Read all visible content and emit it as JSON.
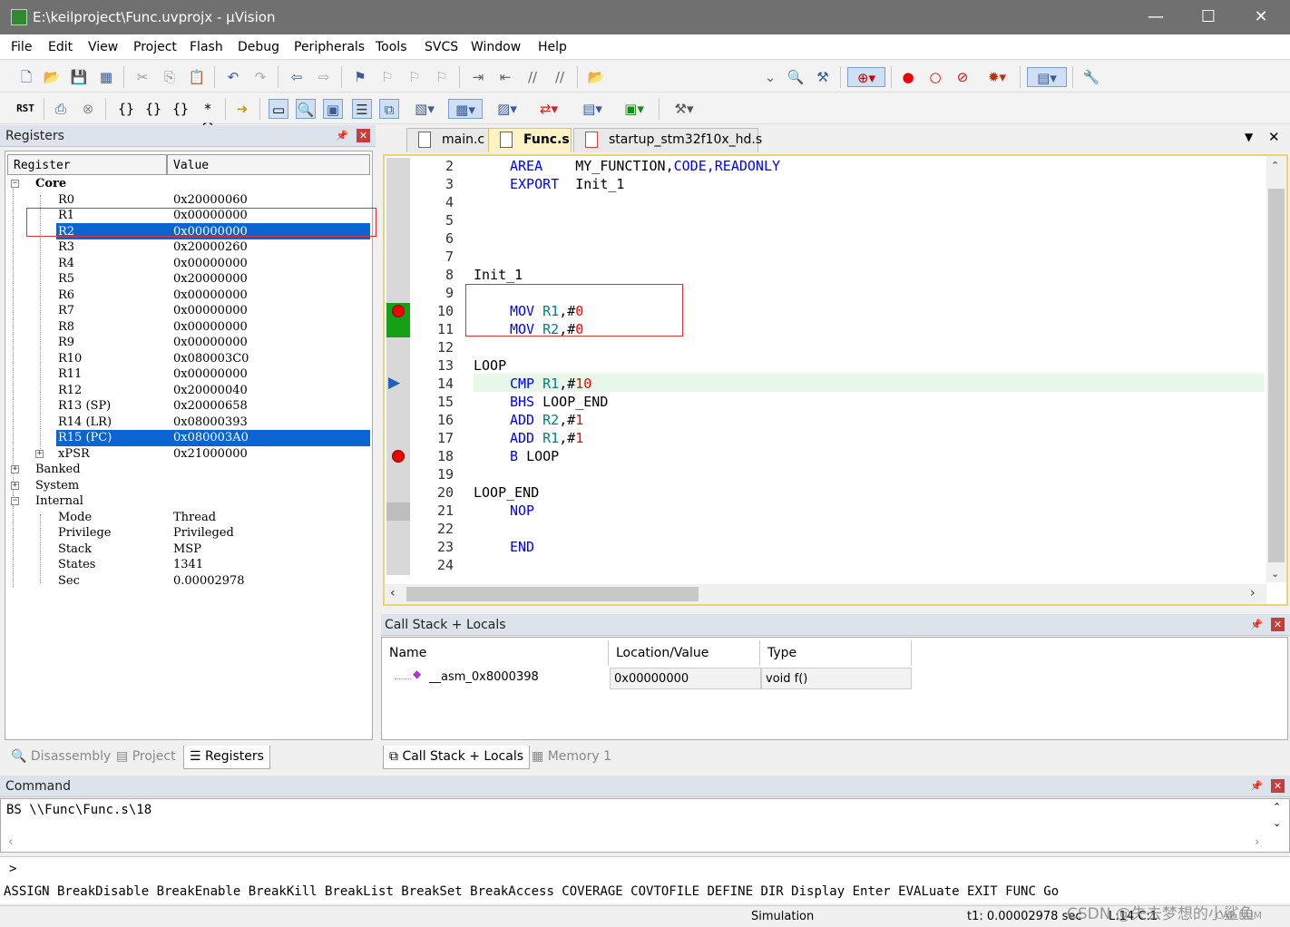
{
  "window": {
    "title": "E:\\keilproject\\Func.uvprojx - µVision",
    "minimize": "—",
    "maximize": "☐",
    "close": "✕"
  },
  "menu": [
    "File",
    "Edit",
    "View",
    "Project",
    "Flash",
    "Debug",
    "Peripherals",
    "Tools",
    "SVCS",
    "Window",
    "Help"
  ],
  "toolbar2": {
    "reset_label": "RST"
  },
  "registers": {
    "panel_title": "Registers",
    "col_register": "Register",
    "col_value": "Value",
    "rows": [
      {
        "name": "Core",
        "value": ""
      },
      {
        "name": "R0",
        "value": "0x20000060"
      },
      {
        "name": "R1",
        "value": "0x00000000"
      },
      {
        "name": "R2",
        "value": "0x00000000"
      },
      {
        "name": "R3",
        "value": "0x20000260"
      },
      {
        "name": "R4",
        "value": "0x00000000"
      },
      {
        "name": "R5",
        "value": "0x20000000"
      },
      {
        "name": "R6",
        "value": "0x00000000"
      },
      {
        "name": "R7",
        "value": "0x00000000"
      },
      {
        "name": "R8",
        "value": "0x00000000"
      },
      {
        "name": "R9",
        "value": "0x00000000"
      },
      {
        "name": "R10",
        "value": "0x080003C0"
      },
      {
        "name": "R11",
        "value": "0x00000000"
      },
      {
        "name": "R12",
        "value": "0x20000040"
      },
      {
        "name": "R13 (SP)",
        "value": "0x20000658"
      },
      {
        "name": "R14 (LR)",
        "value": "0x08000393"
      },
      {
        "name": "R15 (PC)",
        "value": "0x080003A0"
      },
      {
        "name": "xPSR",
        "value": "0x21000000"
      },
      {
        "name": "Banked",
        "value": ""
      },
      {
        "name": "System",
        "value": ""
      },
      {
        "name": "Internal",
        "value": ""
      },
      {
        "name": "Mode",
        "value": "Thread"
      },
      {
        "name": "Privilege",
        "value": "Privileged"
      },
      {
        "name": "Stack",
        "value": "MSP"
      },
      {
        "name": "States",
        "value": "1341"
      },
      {
        "name": "Sec",
        "value": "0.00002978"
      }
    ]
  },
  "left_tabs": [
    "Disassembly",
    "Project",
    "Registers"
  ],
  "editor_tabs": [
    "main.c",
    "Func.s",
    "startup_stm32f10x_hd.s"
  ],
  "editor": {
    "line_numbers": [
      "2",
      "3",
      "4",
      "5",
      "6",
      "7",
      "8",
      "9",
      "10",
      "11",
      "12",
      "13",
      "14",
      "15",
      "16",
      "17",
      "18",
      "19",
      "20",
      "21",
      "22",
      "23",
      "24"
    ],
    "lines": {
      "l2a": "AREA",
      "l2b": "MY_FUNCTION,",
      "l2c": "CODE,",
      "l2d": "READONLY",
      "l3a": "EXPORT",
      "l3b": "Init_1",
      "l8": "Init_1",
      "l10a": "MOV",
      "l10b": "R1",
      "l10c": ",#",
      "l10d": "0",
      "l11a": "MOV",
      "l11b": "R2",
      "l11c": ",#",
      "l11d": "0",
      "l13": "LOOP",
      "l14a": "CMP",
      "l14b": "R1",
      "l14c": ",#",
      "l14d": "10",
      "l15a": "BHS",
      "l15b": "LOOP_END",
      "l16a": "ADD",
      "l16b": "R2",
      "l16c": ",#",
      "l16d": "1",
      "l17a": "ADD",
      "l17b": "R1",
      "l17c": ",#",
      "l17d": "1",
      "l18a": "B",
      "l18b": "LOOP",
      "l20": "LOOP_END",
      "l21": "NOP",
      "l23": "END"
    }
  },
  "callstack": {
    "panel_title": "Call Stack + Locals",
    "col_name": "Name",
    "col_location": "Location/Value",
    "col_type": "Type",
    "row_name": "__asm_0x8000398",
    "row_location": "0x00000000",
    "row_type": "void f()"
  },
  "mid_tabs": [
    "Call Stack + Locals",
    "Memory 1"
  ],
  "command": {
    "panel_title": "Command",
    "output": "BS \\\\Func\\Func.s\\18",
    "prompt": ">",
    "help_line": "ASSIGN BreakDisable BreakEnable BreakKill BreakList BreakSet BreakAccess COVERAGE COVTOFILE DEFINE DIR Display Enter EVALuate EXIT FUNC Go"
  },
  "status": {
    "mode": "Simulation",
    "time": "t1: 0.00002978 sec",
    "position": "L:14 C:1",
    "caps": "CAP NUM",
    "watermark": "CSDN @失去梦想的小鲨鱼"
  },
  "colors": {
    "keyword": "#0000ff",
    "number": "#ff0000",
    "register": "#008080",
    "selection": "#0a64d2",
    "current_line": "#e8f8e8"
  }
}
